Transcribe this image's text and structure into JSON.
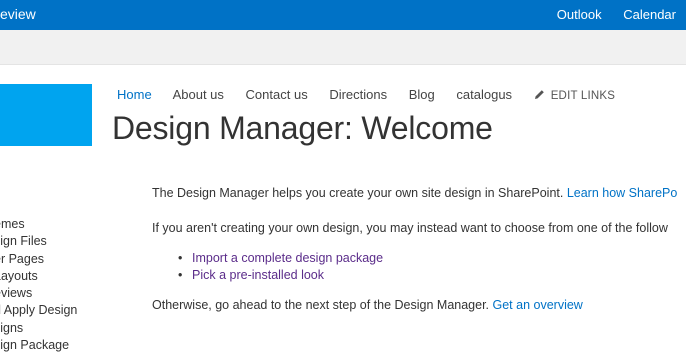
{
  "suitebar": {
    "brand": "eview",
    "apps": [
      "Outlook",
      "Calendar"
    ]
  },
  "topnav": {
    "items": [
      "Home",
      "About us",
      "Contact us",
      "Directions",
      "Blog",
      "catalogus"
    ],
    "edit_links": "EDIT LINKS"
  },
  "page": {
    "title": "Design Manager: Welcome"
  },
  "quicklaunch": {
    "items": [
      "emes",
      "sign Files",
      "er Pages",
      "Layouts",
      "eviews",
      "d Apply Design",
      "signs",
      "sign Package"
    ]
  },
  "content": {
    "p1_text": "The Design Manager helps you create your own site design in SharePoint. ",
    "p1_link": "Learn how SharePo",
    "p2_text": "If you aren't creating your own design, you may instead want to choose from one of the follow",
    "options": [
      "Import a complete design package",
      "Pick a pre-installed look"
    ],
    "p3_text": "Otherwise, go ahead to the next step of the Design Manager. ",
    "p3_link": "Get an overview"
  },
  "colors": {
    "suitebar": "#0072c6",
    "logo": "#00a4ef",
    "link": "#0072c6",
    "visited_link": "#5b2c8a"
  }
}
